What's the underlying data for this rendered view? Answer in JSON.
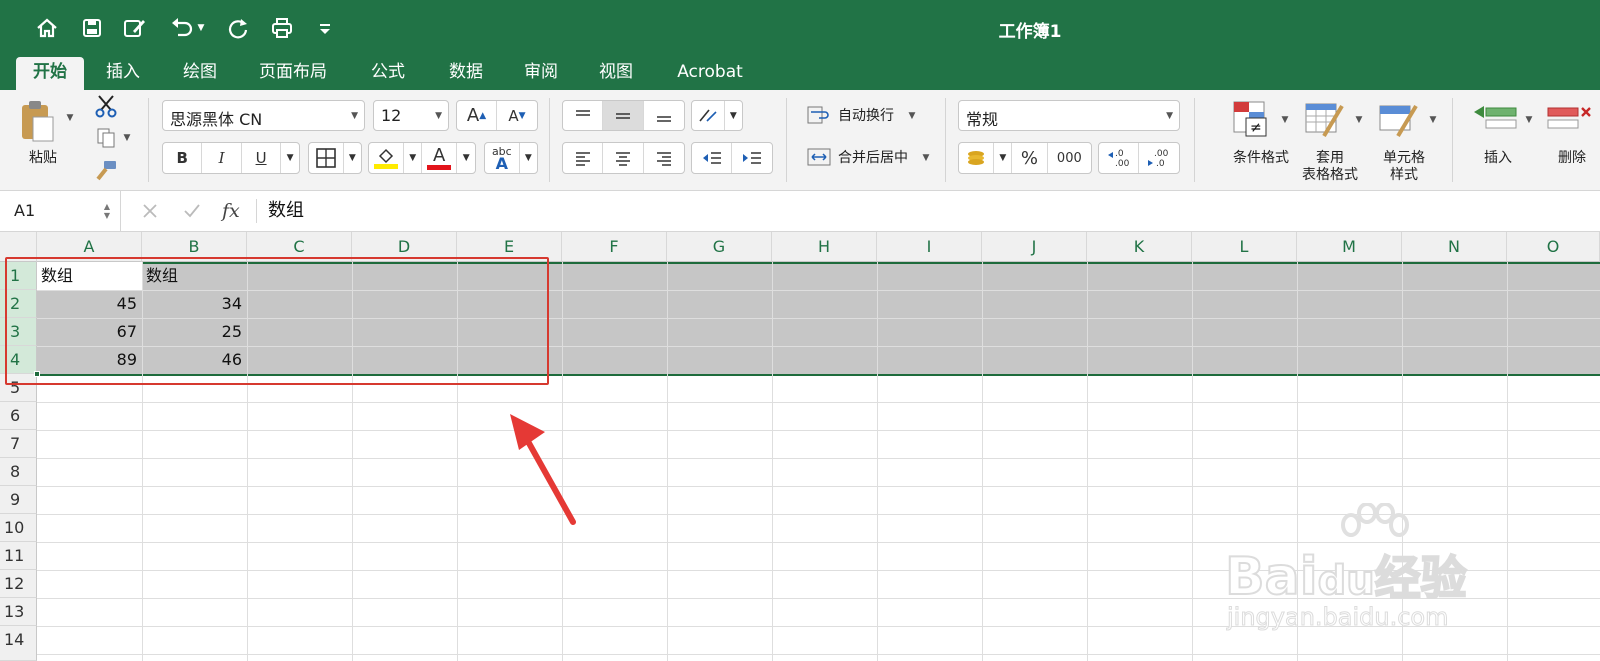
{
  "window": {
    "title": "工作簿1"
  },
  "quick_access": {
    "icons": [
      "home-icon",
      "save-icon",
      "edit-icon",
      "undo-icon",
      "redo-icon",
      "print-icon",
      "customize-icon"
    ]
  },
  "tabs": [
    {
      "label": "开始",
      "active": true
    },
    {
      "label": "插入"
    },
    {
      "label": "绘图"
    },
    {
      "label": "页面布局"
    },
    {
      "label": "公式"
    },
    {
      "label": "数据"
    },
    {
      "label": "审阅"
    },
    {
      "label": "视图"
    },
    {
      "label": "Acrobat"
    }
  ],
  "ribbon": {
    "paste_label": "粘贴",
    "font_name": "思源黑体 CN",
    "font_size": "12",
    "bold": "B",
    "italic": "I",
    "underline": "U",
    "font_color_glyph": "A",
    "abc_glyph": "abc",
    "wrap_text": "自动换行",
    "merge_center": "合并后居中",
    "number_format": "常规",
    "percent": "%",
    "thousands": "000",
    "conditional_format": "条件格式",
    "format_table_line1": "套用",
    "format_table_line2": "表格格式",
    "cell_style_line1": "单元格",
    "cell_style_line2": "样式",
    "insert": "插入",
    "delete": "删除",
    "accent_color": "#217346"
  },
  "formula_bar": {
    "name_box": "A1",
    "fx": "fx",
    "content": "数组"
  },
  "sheet": {
    "columns": [
      "A",
      "B",
      "C",
      "D",
      "E",
      "F",
      "G",
      "H",
      "I",
      "J",
      "K",
      "L",
      "M",
      "N",
      "O"
    ],
    "rows": [
      "1",
      "2",
      "3",
      "4",
      "5",
      "6",
      "7",
      "8",
      "9",
      "10",
      "11",
      "12",
      "13",
      "14"
    ],
    "selected_rows": [
      "1",
      "2",
      "3",
      "4"
    ],
    "cells": {
      "A1": "数组",
      "B1": "数组",
      "A2": "45",
      "B2": "34",
      "A3": "67",
      "B3": "25",
      "A4": "89",
      "B4": "46"
    },
    "highlight_color": "#d6392f"
  },
  "watermark": {
    "brand": "Bai",
    "brand2": "du",
    "text_cn": "经验",
    "url": "jingyan.baidu.com"
  }
}
